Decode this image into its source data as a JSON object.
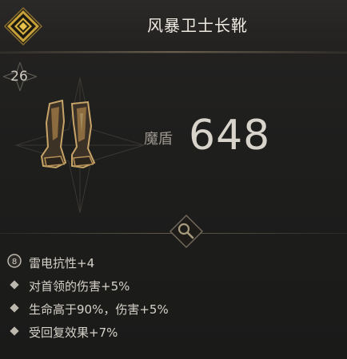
{
  "item": {
    "name": "风暴卫士长靴",
    "level": "26",
    "stat_label": "魔盾",
    "stat_value": "648"
  },
  "icons": {
    "rarity": "diamond-rarity-emblem-icon",
    "level": "star-level-badge-icon",
    "inspect": "magnifier-icon",
    "item_art": "boots-icon",
    "rune": "rune-socket-icon",
    "bullet": "diamond-bullet-icon"
  },
  "affixes": [
    {
      "icon": "rune",
      "text": "雷电抗性+4"
    },
    {
      "icon": "bullet",
      "text": "对首领的伤害+5%"
    },
    {
      "icon": "bullet",
      "text": "生命高于90%，伤害+5%"
    },
    {
      "icon": "bullet",
      "text": "受回复效果+7%"
    }
  ],
  "colors": {
    "rarity_gold": "#c9a13a",
    "background": "#1b1b1a",
    "text": "#e3e0d8"
  }
}
